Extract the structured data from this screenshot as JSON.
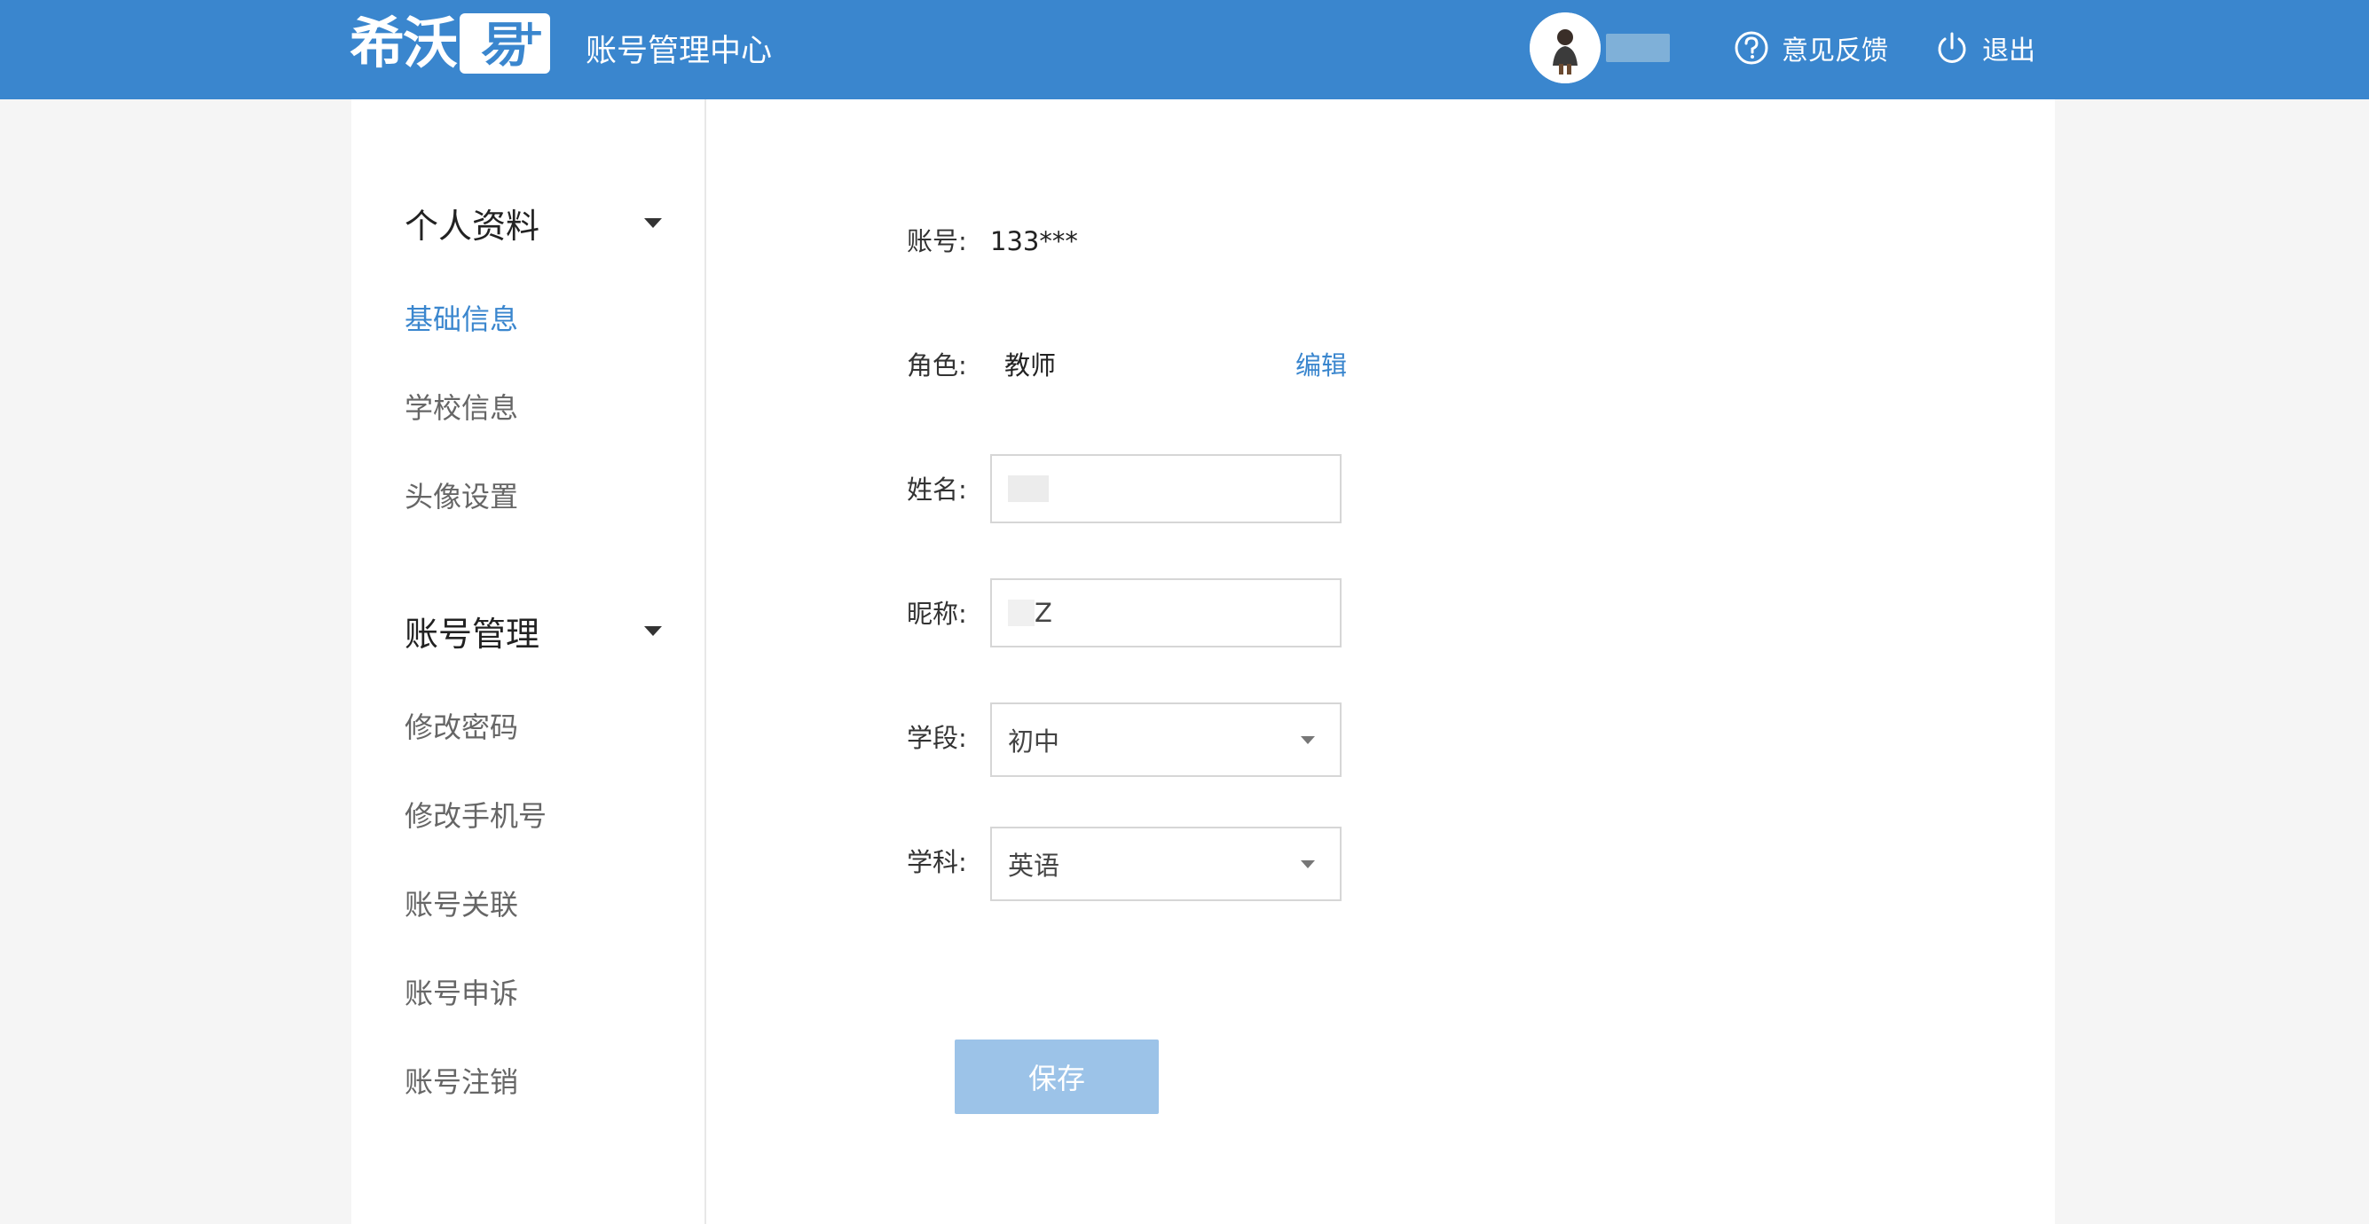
{
  "header": {
    "logo_text": "希沃",
    "logo_box_text": "易",
    "logo_plus": "+",
    "app_title": "账号管理中心",
    "feedback_label": "意见反馈",
    "logout_label": "退出"
  },
  "sidebar": {
    "groups": [
      {
        "title": "个人资料",
        "items": [
          "基础信息",
          "学校信息",
          "头像设置"
        ]
      },
      {
        "title": "账号管理",
        "items": [
          "修改密码",
          "修改手机号",
          "账号关联",
          "账号申诉",
          "账号注销"
        ]
      }
    ],
    "active_item": "基础信息"
  },
  "form": {
    "account_label": "账号:",
    "account_value": "133***",
    "role_label": "角色:",
    "role_value": "教师",
    "edit_label": "编辑",
    "name_label": "姓名:",
    "nickname_label": "昵称:",
    "nickname_value": "Z",
    "stage_label": "学段:",
    "stage_value": "初中",
    "subject_label": "学科:",
    "subject_value": "英语",
    "save_label": "保存"
  },
  "colors": {
    "brand": "#3a86ce",
    "save_disabled": "#9cc3e8"
  }
}
